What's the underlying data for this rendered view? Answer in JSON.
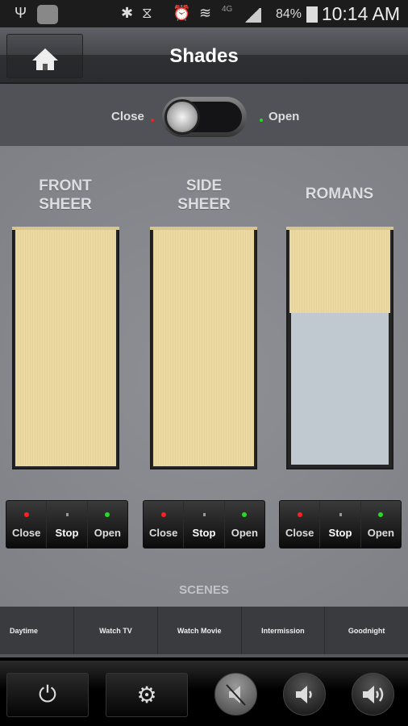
{
  "status_bar": {
    "time": "10:14 AM",
    "battery": "84%",
    "network": "4G",
    "icons": [
      "usb-icon",
      "app-icon",
      "bluetooth-icon",
      "vibrate-icon",
      "alarm-icon",
      "wifi-icon",
      "signal-icon",
      "battery-charging-icon"
    ]
  },
  "header": {
    "title": "Shades",
    "home_icon": "home-icon"
  },
  "master_toggle": {
    "left_label": "Close",
    "right_label": "Open",
    "state": "Close"
  },
  "shades": [
    {
      "name_line1": "FRONT",
      "name_line2": "SHEER",
      "closed_fraction": 1.0,
      "buttons": {
        "close": "Close",
        "stop": "Stop",
        "open": "Open"
      }
    },
    {
      "name_line1": "SIDE",
      "name_line2": "SHEER",
      "closed_fraction": 1.0,
      "buttons": {
        "close": "Close",
        "stop": "Stop",
        "open": "Open"
      }
    },
    {
      "name_line1": "ROMANS",
      "name_line2": "",
      "closed_fraction": 0.35,
      "buttons": {
        "close": "Close",
        "stop": "Stop",
        "open": "Open"
      }
    }
  ],
  "scenes": {
    "label": "SCENES",
    "items": [
      "Daytime",
      "Watch TV",
      "Watch Movie",
      "Intermission",
      "Goodnight"
    ]
  },
  "bottom_bar": {
    "buttons": [
      "power-icon",
      "settings-icon",
      "mute-icon",
      "volume-down-icon",
      "volume-up-icon"
    ]
  },
  "colors": {
    "fabric": "#ecd9a2",
    "close_indicator": "#ff2020",
    "open_indicator": "#22dd22"
  }
}
